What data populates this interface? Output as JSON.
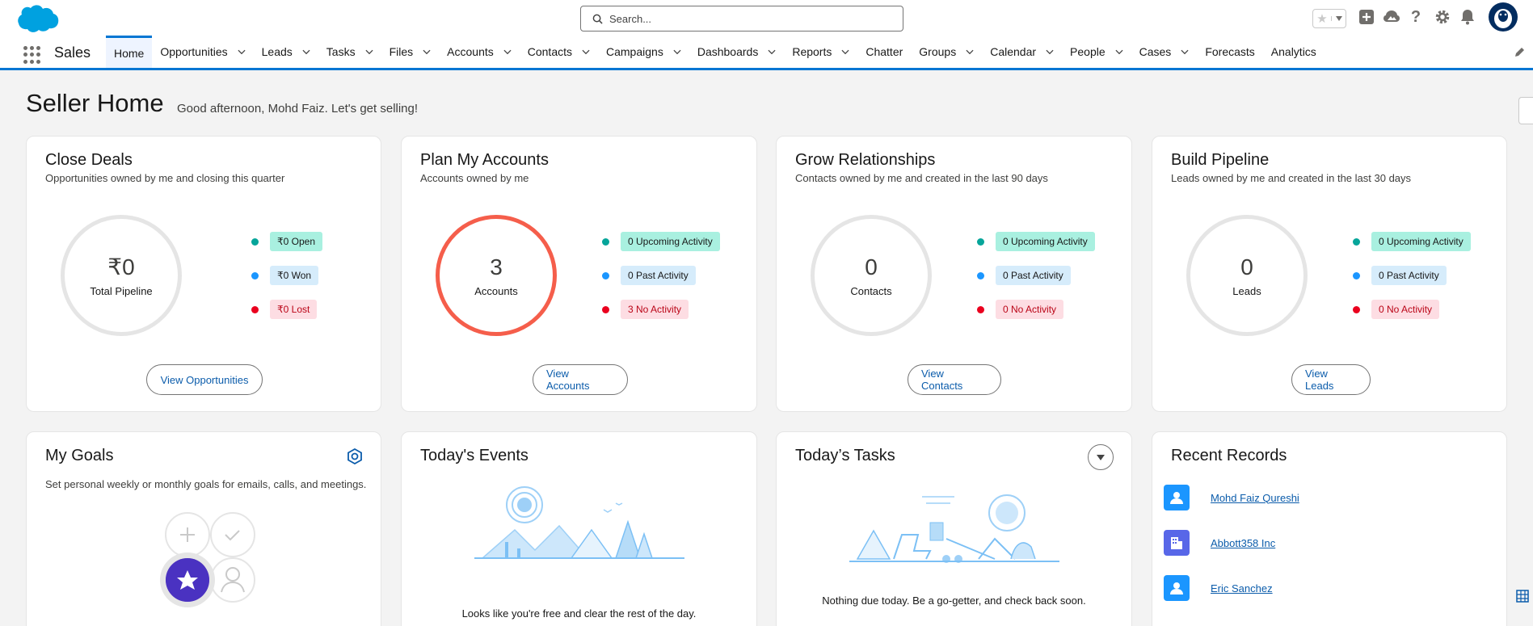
{
  "header": {
    "search_placeholder": "Search..."
  },
  "nav": {
    "app_name": "Sales",
    "tabs": [
      {
        "label": "Home",
        "dropdown": false,
        "active": true
      },
      {
        "label": "Opportunities",
        "dropdown": true
      },
      {
        "label": "Leads",
        "dropdown": true
      },
      {
        "label": "Tasks",
        "dropdown": true
      },
      {
        "label": "Files",
        "dropdown": true
      },
      {
        "label": "Accounts",
        "dropdown": true
      },
      {
        "label": "Contacts",
        "dropdown": true
      },
      {
        "label": "Campaigns",
        "dropdown": true
      },
      {
        "label": "Dashboards",
        "dropdown": true
      },
      {
        "label": "Reports",
        "dropdown": true
      },
      {
        "label": "Chatter",
        "dropdown": false
      },
      {
        "label": "Groups",
        "dropdown": true
      },
      {
        "label": "Calendar",
        "dropdown": true
      },
      {
        "label": "People",
        "dropdown": true
      },
      {
        "label": "Cases",
        "dropdown": true
      },
      {
        "label": "Forecasts",
        "dropdown": false
      },
      {
        "label": "Analytics",
        "dropdown": false
      }
    ]
  },
  "page": {
    "title": "Seller Home",
    "greeting": "Good afternoon, Mohd Faiz. Let's get selling!"
  },
  "cards": {
    "close_deals": {
      "title": "Close Deals",
      "subtitle": "Opportunities owned by me and closing this quarter",
      "ring_value": "₹0",
      "ring_label": "Total Pipeline",
      "legend": [
        "₹0 Open",
        "₹0 Won",
        "₹0 Lost"
      ],
      "button": "View Opportunities"
    },
    "plan_accounts": {
      "title": "Plan My Accounts",
      "subtitle": "Accounts owned by me",
      "ring_value": "3",
      "ring_label": "Accounts",
      "legend": [
        "0 Upcoming Activity",
        "0 Past Activity",
        "3 No Activity"
      ],
      "button": "View Accounts"
    },
    "grow_relationships": {
      "title": "Grow Relationships",
      "subtitle": "Contacts owned by me and created in the last 90 days",
      "ring_value": "0",
      "ring_label": "Contacts",
      "legend": [
        "0 Upcoming Activity",
        "0 Past Activity",
        "0 No Activity"
      ],
      "button": "View Contacts"
    },
    "build_pipeline": {
      "title": "Build Pipeline",
      "subtitle": "Leads owned by me and created in the last 30 days",
      "ring_value": "0",
      "ring_label": "Leads",
      "legend": [
        "0 Upcoming Activity",
        "0 Past Activity",
        "0 No Activity"
      ],
      "button": "View Leads"
    },
    "my_goals": {
      "title": "My Goals",
      "subtitle": "Set personal weekly or monthly goals for emails, calls, and meetings."
    },
    "todays_events": {
      "title": "Today's Events",
      "empty_text": "Looks like you're free and clear the rest of the day."
    },
    "todays_tasks": {
      "title": "Today’s Tasks",
      "empty_text": "Nothing due today. Be a go-getter, and check back soon."
    },
    "recent_records": {
      "title": "Recent Records",
      "items": [
        {
          "name": "Mohd Faiz Qureshi",
          "icon": "contact-icon",
          "color": "#1b96ff"
        },
        {
          "name": "Abbott358 Inc",
          "icon": "account-icon",
          "color": "#5867e8"
        },
        {
          "name": "Eric Sanchez",
          "icon": "contact-icon",
          "color": "#1b96ff"
        }
      ]
    }
  },
  "colors": {
    "brand": "#0176d3",
    "accounts_ring": "#f55e4b",
    "teal_dot": "#06a59a",
    "blue_dot": "#1b96ff",
    "red_dot": "#ea001e"
  }
}
